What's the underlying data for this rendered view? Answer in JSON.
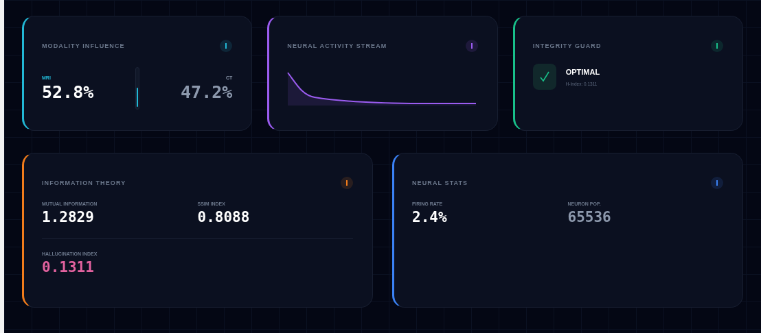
{
  "cards": [
    {
      "kind": "modality",
      "title": "MODALITY INFLUENCE",
      "color": "#22b8d6",
      "left": {
        "label": "MRI",
        "value": "52.8%"
      },
      "right": {
        "label": "CT",
        "value": "47.2%"
      },
      "balance": {
        "level": 0.5
      }
    },
    {
      "kind": "stream",
      "title": "NEURAL ACTIVITY STREAM",
      "color": "#9b5cf0"
    },
    {
      "kind": "guard",
      "title": "INTEGRITY GUARD",
      "color": "#18c08a",
      "status": "OPTIMAL",
      "detail": "H-Index: 0.1311"
    },
    {
      "kind": "metrics",
      "title": "INFORMATION THEORY",
      "color": "#f27c1b",
      "metrics": [
        {
          "label": "MUTUAL INFORMATION",
          "value": "1.2829",
          "color": "#ffffff"
        },
        {
          "label": "SSIM INDEX",
          "value": "0.8088",
          "color": "#ffffff"
        }
      ],
      "footer": {
        "label": "HALLUCINATION INDEX",
        "value": "0.1311",
        "color": "#e3629f"
      }
    },
    {
      "kind": "metrics",
      "title": "NEURAL STATS",
      "color": "#3b82f6",
      "metrics": [
        {
          "label": "FIRING RATE",
          "value": "2.4%",
          "color": "#ffffff"
        },
        {
          "label": "NEURON POP.",
          "value": "65536",
          "color": "#8d99ad"
        }
      ]
    }
  ]
}
